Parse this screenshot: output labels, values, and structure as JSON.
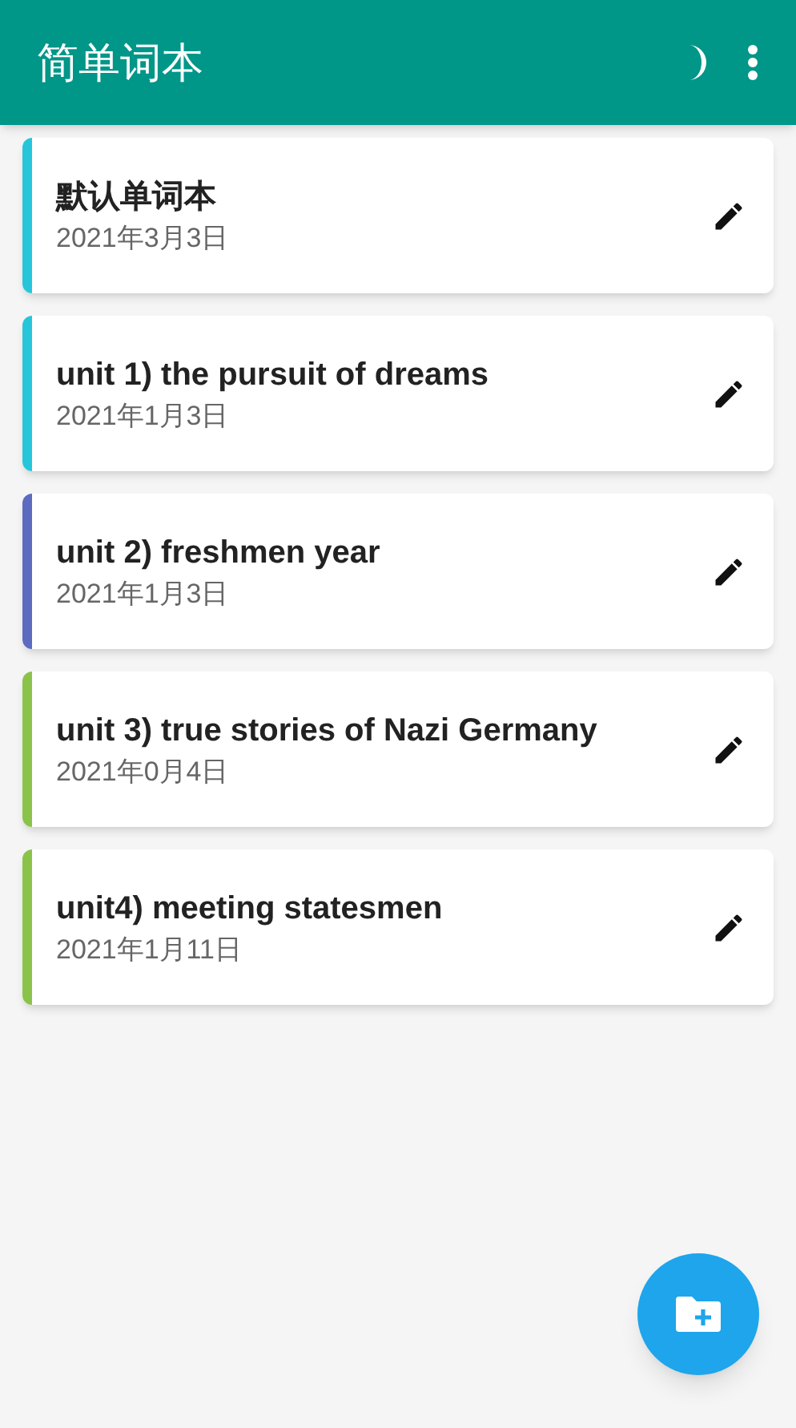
{
  "app_bar": {
    "title": "简单词本"
  },
  "notebooks": [
    {
      "title": "默认单词本",
      "date": "2021年3月3日",
      "color": "#26c6da"
    },
    {
      "title": "unit 1) the pursuit of dreams",
      "date": "2021年1月3日",
      "color": "#26c6da"
    },
    {
      "title": "unit 2) freshmen year",
      "date": "2021年1月3日",
      "color": "#5c6bc0"
    },
    {
      "title": "unit 3) true stories of Nazi Germany",
      "date": "2021年0月4日",
      "color": "#8bc34a"
    },
    {
      "title": "unit4) meeting statesmen",
      "date": "2021年1月11日",
      "color": "#8bc34a"
    }
  ]
}
